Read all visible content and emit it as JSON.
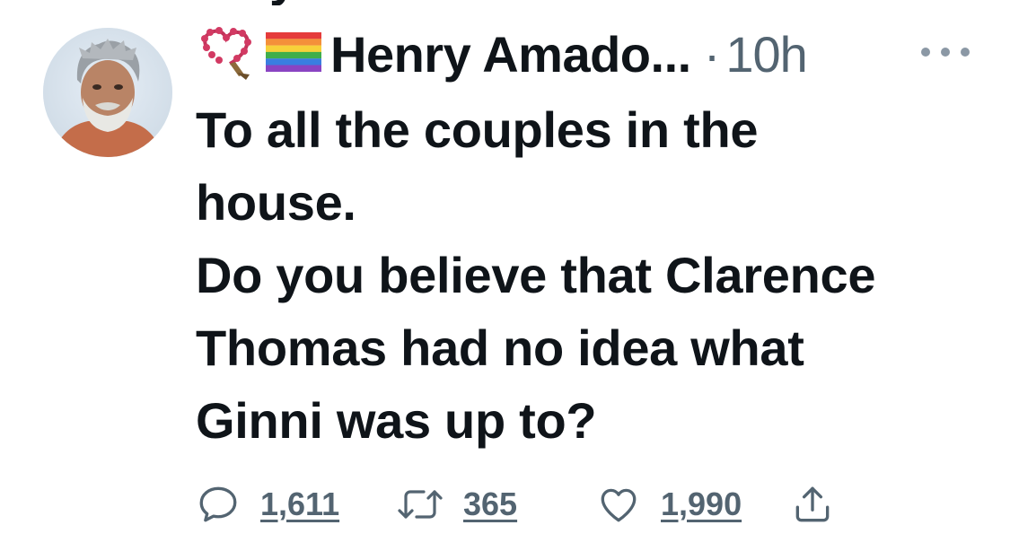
{
  "tweet": {
    "author_name": "Henry Amado...",
    "separator": "·",
    "timestamp": "10h",
    "text_lines": [
      "To all the couples in the",
      "house.",
      "Do you believe that Clarence",
      "Thomas had no idea what",
      "Ginni was up to?"
    ]
  },
  "actions": {
    "replies": "1,611",
    "retweets": "365",
    "likes": "1,990"
  },
  "icons": {
    "prayer_beads": "prayer-beads-emoji",
    "rainbow_flag": "rainbow-flag-emoji",
    "more": "more-icon",
    "reply": "reply-icon",
    "retweet": "retweet-icon",
    "like": "heart-icon",
    "share": "share-icon"
  },
  "colors": {
    "text": "#0f1419",
    "secondary": "#536471",
    "icon": "#536471"
  }
}
